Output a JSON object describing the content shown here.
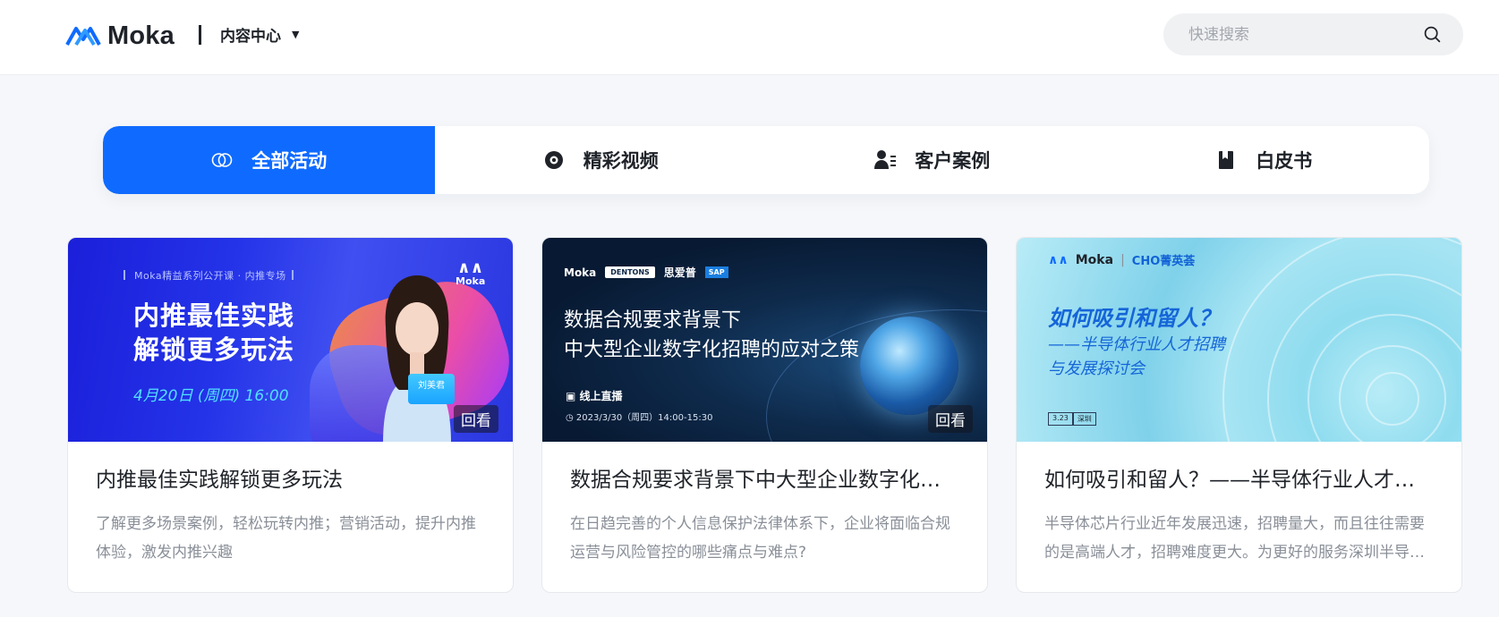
{
  "header": {
    "brand": "Moka",
    "menu_label": "内容中心",
    "search_placeholder": "快速搜索"
  },
  "tabs": [
    {
      "label": "全部活动",
      "icon": "circles-icon",
      "active": true
    },
    {
      "label": "精彩视频",
      "icon": "eye-icon",
      "active": false
    },
    {
      "label": "客户案例",
      "icon": "user-list-icon",
      "active": false
    },
    {
      "label": "白皮书",
      "icon": "book-icon",
      "active": false
    }
  ],
  "cards": [
    {
      "title": "内推最佳实践解锁更多玩法",
      "desc": "了解更多场景案例，轻松玩转内推；营销活动，提升内推体验，激发内推兴趣",
      "badge": "回看",
      "thumb": {
        "series": "Moka精益系列公开课 · 内推专场",
        "head_line1": "内推最佳实践",
        "head_line2": "解锁更多玩法",
        "date": "4月20日 (周四) 16:00",
        "logo": "Moka",
        "speaker": "刘美君"
      }
    },
    {
      "title": "数据合规要求背景下中大型企业数字化招聘的应对之策",
      "desc": "在日趋完善的个人信息保护法律体系下，企业将面临合规运营与风险管控的哪些痛点与难点?",
      "badge": "回看",
      "thumb": {
        "logo1": "Moka",
        "logo2": "DENTONS",
        "logo3": "思爱普",
        "logo4": "SAP",
        "head_line1": "数据合规要求背景下",
        "head_line2": "中大型企业数字化招聘的应对之策",
        "live": "线上直播",
        "time": "2023/3/30（周四）14:00-15:30"
      }
    },
    {
      "title": "如何吸引和留人？——半导体行业人才招聘与发展探讨会",
      "desc": "半导体芯片行业近年发展迅速，招聘量大，而且往往需要的是高端人才，招聘难度更大。为更好的服务深圳半导体企业",
      "thumb": {
        "logo1": "Moka",
        "logo2": "CHO菁英荟",
        "head": "如何吸引和留人？",
        "sub_line1": "——半导体行业人才招聘",
        "sub_line2": "与发展探讨会",
        "tag1": "3.23",
        "tag2": "深圳"
      }
    }
  ],
  "colors": {
    "accent": "#0f6bff",
    "background": "#f5f7fa",
    "text_primary": "#1f2329",
    "text_secondary": "#8a8f98"
  }
}
